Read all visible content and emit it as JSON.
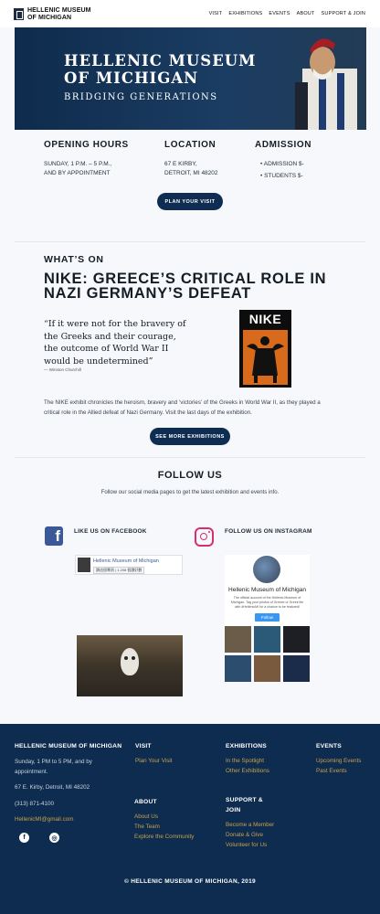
{
  "header": {
    "logo_line1": "HELLENIC MUSEUM",
    "logo_line2": "OF MICHIGAN",
    "nav": [
      "VISIT",
      "EXHIBITIONS",
      "EVENTS",
      "ABOUT",
      "SUPPORT & JOIN"
    ]
  },
  "hero": {
    "title_line1": "HELLENIC MUSEUM",
    "title_line2": "OF MICHIGAN",
    "subtitle": "BRIDGING GENERATIONS"
  },
  "info": {
    "hours": {
      "heading": "OPENING HOURS",
      "line1": "SUNDAY, 1 P.M. – 5 P.M.,",
      "line2": "AND BY APPOINTMENT"
    },
    "location": {
      "heading": "LOCATION",
      "line1": "67 E KIRBY,",
      "line2": "DETROIT, MI 48202"
    },
    "admission": {
      "heading": "ADMISSION",
      "item1": "ADMISSION $-",
      "item2": "STUDENTS $-"
    },
    "plan_button": "PLAN YOUR VISIT"
  },
  "whats_on": {
    "heading": "WHAT’S ON",
    "exhibit_title": "NIKE: GREECE’S CRITICAL ROLE IN NAZI GERMANY’S DEFEAT",
    "quote": "“If it were not for the bravery of the Greeks and their courage, the outcome of World War II would be undetermined”",
    "quote_by": "— Winston Churchill",
    "poster_title": "NIKE",
    "body": "The NIKE exhibit chronicles the heroism, bravery and ‘victories’ of the Greeks in World War II, as they played a critical role in the Allied defeat of Nazi Germany. Visit the last days of the exhibition.",
    "more_button": "SEE MORE EXHIBITIONS"
  },
  "follow": {
    "heading": "FOLLOW US",
    "text": "Follow our social media pages to get the latest exhibition and events info.",
    "facebook_heading": "LIKE US ON FACEBOOK",
    "instagram_heading": "FOLLOW US ON INSTAGRAM",
    "fb_page_name": "Hellenic Museum of Michigan",
    "fb_like": "讚這個專頁",
    "fb_likes_count": "1,208 個讚好數",
    "ig_name": "Hellenic Museum of Michigan",
    "ig_bio": "The official account of the Hellenic Museum of Michigan. Tag your photos of Greece or Greek life with #HellenicMI for a chance to be featured!",
    "ig_follow": "Follow"
  },
  "footer": {
    "org_heading": "HELLENIC MUSEUM OF MICHIGAN",
    "hours_line1": "Sunday, 1 PM to 5 PM, and by",
    "hours_line2": "appointment.",
    "address": "67 E. Kirby, Detroit, MI 48202",
    "phone": "(313) 871-4100",
    "email": "HellenicMI@gmail.com",
    "visit_heading": "VISIT",
    "visit_link": "Plan Your Visit",
    "exhibitions_heading": "EXHIBITIONS",
    "exhibitions_links": [
      "In the Spotlight",
      "Other Exhibitions"
    ],
    "events_heading": "EVENTS",
    "events_links": [
      "Upcoming Events",
      "Past Events"
    ],
    "about_heading": "ABOUT",
    "about_links": [
      "About Us",
      "The Team",
      "Explore the Community"
    ],
    "support_heading_line1": "SUPPORT &",
    "support_heading_line2": "JOIN",
    "support_links": [
      "Become a Member",
      "Donate & Give",
      "Volunteer for Us"
    ],
    "copyright": "© HELLENIC MUSEUM OF MICHIGAN,  2019"
  },
  "colors": {
    "navy": "#0d2c4f",
    "gold_link": "#c8a14b",
    "button": "#0f2d52"
  }
}
